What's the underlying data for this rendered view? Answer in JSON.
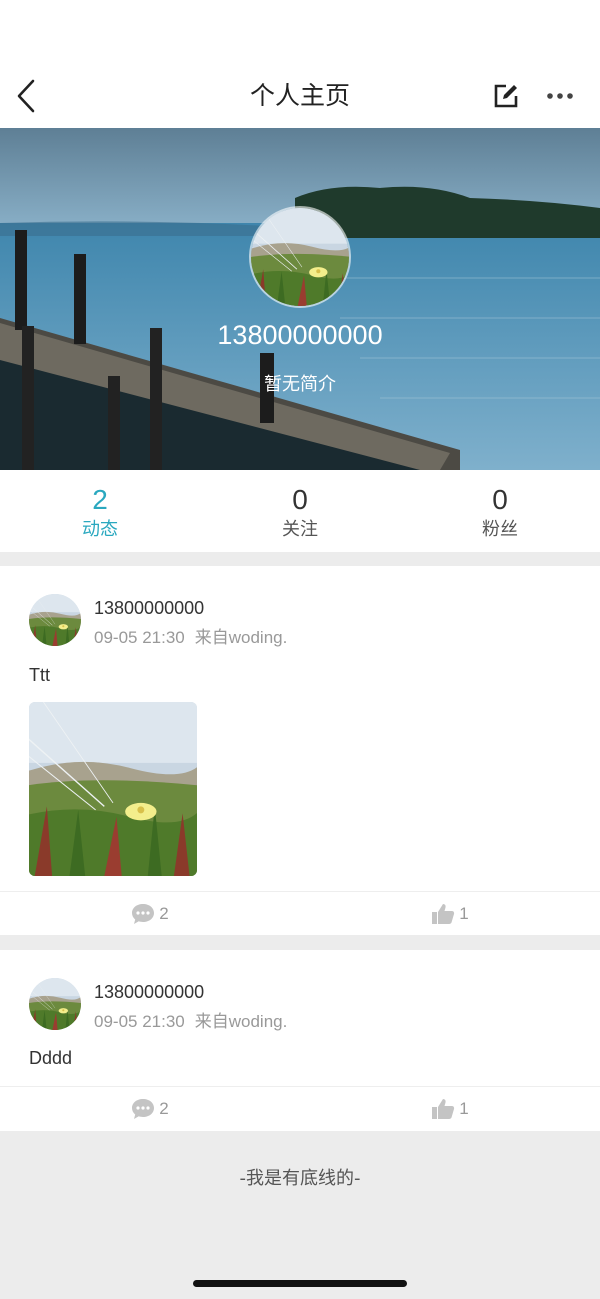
{
  "header": {
    "title": "个人主页",
    "back_icon": "chevron-left-icon",
    "edit_icon": "edit-icon",
    "more_icon": "more-horizontal-icon"
  },
  "profile": {
    "username": "13800000000",
    "bio": "暂无简介"
  },
  "stats": [
    {
      "value": "2",
      "label": "动态",
      "active": true
    },
    {
      "value": "0",
      "label": "关注",
      "active": false
    },
    {
      "value": "0",
      "label": "粉丝",
      "active": false
    }
  ],
  "posts": [
    {
      "author": "13800000000",
      "time": "09-05 21:30",
      "source": "来自woding.",
      "text": "Ttt",
      "comments": "2",
      "likes": "1"
    },
    {
      "author": "13800000000",
      "time": "09-05 21:30",
      "source": "来自woding.",
      "text": "Dddd",
      "comments": "2",
      "likes": "1"
    }
  ],
  "footer": {
    "text": "-我是有底线的-"
  },
  "colors": {
    "accent": "#2aa8bf",
    "background": "#ececec"
  }
}
